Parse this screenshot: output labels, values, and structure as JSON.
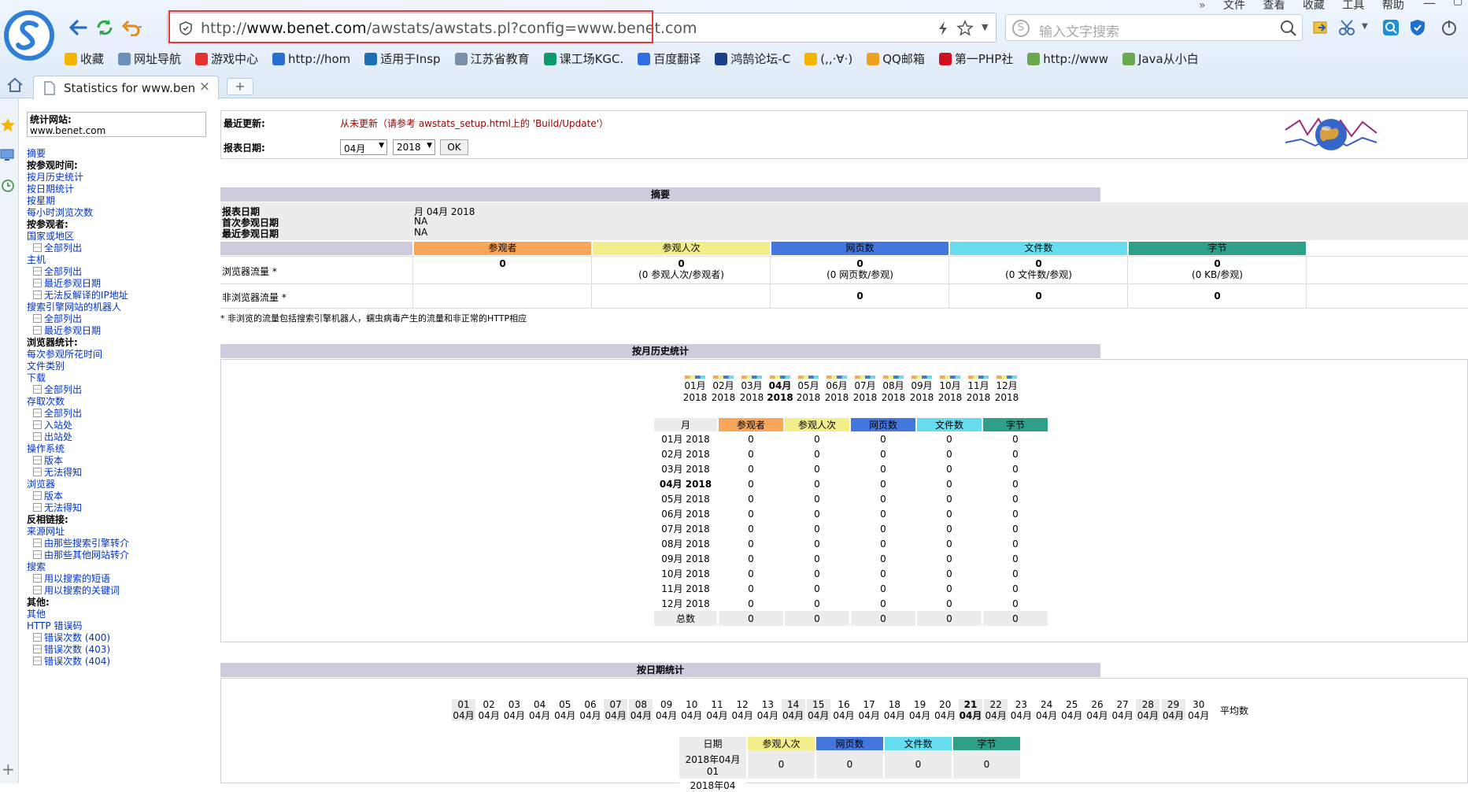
{
  "browser": {
    "url_scheme": "http://",
    "url_host": "www.benet.com",
    "url_path": "/awstats/awstats.pl?config=www.benet.com",
    "search_placeholder": "输入文字搜索",
    "menu": [
      "文件",
      "查看",
      "收藏",
      "工具",
      "帮助"
    ],
    "bookmarks": [
      {
        "label": "收藏",
        "icon": "star-icon",
        "color": "#f5b400"
      },
      {
        "label": "网址导航",
        "icon": "globe-icon",
        "color": "#6a8fb8"
      },
      {
        "label": "游戏中心",
        "icon": "game-icon",
        "color": "#e53030"
      },
      {
        "label": "http://hom",
        "icon": "home-icon",
        "color": "#2a6fd0"
      },
      {
        "label": "适用于Insp",
        "icon": "dell-icon",
        "color": "#1f6fb5"
      },
      {
        "label": "江苏省教育",
        "icon": "doc-icon",
        "color": "#7a8fa8"
      },
      {
        "label": "课工场KGC.",
        "icon": "kgc-icon",
        "color": "#0b9a6a"
      },
      {
        "label": "百度翻译",
        "icon": "translate-icon",
        "color": "#2f6de0"
      },
      {
        "label": "鸿鹄论坛-C",
        "icon": "forum-icon",
        "color": "#1b3f8a"
      },
      {
        "label": "(,,·∀·)",
        "icon": "star-icon",
        "color": "#f5b400"
      },
      {
        "label": "QQ邮箱",
        "icon": "qqmail-icon",
        "color": "#f0a020"
      },
      {
        "label": "第一PHP社",
        "icon": "php-icon",
        "color": "#d0101e"
      },
      {
        "label": "http://www",
        "icon": "page-icon",
        "color": "#6aa84f"
      },
      {
        "label": "Java从小白",
        "icon": "page-icon",
        "color": "#6aa84f"
      }
    ],
    "tab_title": "Statistics for www.ben",
    "tab_new": "+"
  },
  "menu": {
    "site_label": "统计网站:",
    "site_value": "www.benet.com",
    "items": [
      {
        "t": "摘要",
        "k": "link"
      },
      {
        "t": "按参观时间:",
        "k": "head"
      },
      {
        "t": "按月历史统计",
        "k": "link"
      },
      {
        "t": "按日期统计",
        "k": "link"
      },
      {
        "t": "按星期",
        "k": "link"
      },
      {
        "t": "每小时浏览次数",
        "k": "link"
      },
      {
        "t": "按参观者:",
        "k": "head"
      },
      {
        "t": "国家或地区",
        "k": "link"
      },
      {
        "t": "全部列出",
        "k": "sub"
      },
      {
        "t": "主机",
        "k": "link"
      },
      {
        "t": "全部列出",
        "k": "sub"
      },
      {
        "t": "最近参观日期",
        "k": "sub"
      },
      {
        "t": "无法反解译的IP地址",
        "k": "sub"
      },
      {
        "t": "搜索引擎网站的机器人",
        "k": "link"
      },
      {
        "t": "全部列出",
        "k": "sub"
      },
      {
        "t": "最近参观日期",
        "k": "sub"
      },
      {
        "t": "浏览器统计:",
        "k": "head"
      },
      {
        "t": "每次参观所花时间",
        "k": "link"
      },
      {
        "t": "文件类别",
        "k": "link"
      },
      {
        "t": "下载",
        "k": "link"
      },
      {
        "t": "全部列出",
        "k": "sub"
      },
      {
        "t": "存取次数",
        "k": "link"
      },
      {
        "t": "全部列出",
        "k": "sub"
      },
      {
        "t": "入站处",
        "k": "sub"
      },
      {
        "t": "出站处",
        "k": "sub"
      },
      {
        "t": "操作系统",
        "k": "link"
      },
      {
        "t": "版本",
        "k": "sub"
      },
      {
        "t": "无法得知",
        "k": "sub"
      },
      {
        "t": "浏览器",
        "k": "link"
      },
      {
        "t": "版本",
        "k": "sub"
      },
      {
        "t": "无法得知",
        "k": "sub"
      },
      {
        "t": "反相链接:",
        "k": "head"
      },
      {
        "t": "来源网址",
        "k": "link"
      },
      {
        "t": "由那些搜索引擎转介",
        "k": "sub"
      },
      {
        "t": "由那些其他网站转介",
        "k": "sub"
      },
      {
        "t": "搜索",
        "k": "link"
      },
      {
        "t": "用以搜索的短语",
        "k": "sub"
      },
      {
        "t": "用以搜索的关键词",
        "k": "sub"
      },
      {
        "t": "其他:",
        "k": "head"
      },
      {
        "t": "其他",
        "k": "link"
      },
      {
        "t": "HTTP 错误码",
        "k": "link"
      },
      {
        "t": "错误次数 (400)",
        "k": "sub"
      },
      {
        "t": "错误次数 (403)",
        "k": "sub"
      },
      {
        "t": "错误次数 (404)",
        "k": "sub"
      }
    ]
  },
  "info": {
    "update_label": "最近更新:",
    "update_value": "从未更新（请参考 awstats_setup.html上的 'Build/Update'）",
    "date_label": "报表日期:",
    "month_value": "04月",
    "year_value": "2018",
    "ok_label": "OK"
  },
  "summary": {
    "title": "摘要",
    "rows": [
      {
        "label": "报表日期",
        "value": "月 04月 2018"
      },
      {
        "label": "首次参观日期",
        "value": "NA"
      },
      {
        "label": "最近参观日期",
        "value": "NA"
      }
    ],
    "headers": [
      "参观者",
      "参观人次",
      "网页数",
      "文件数",
      "字节"
    ],
    "header_colors": [
      "#f9a65a",
      "#f4ee8a",
      "#4477dd",
      "#66ddee",
      "#2ea08a"
    ],
    "browser_label": "浏览器流量 *",
    "browser_values": [
      {
        "main": "0",
        "sub": ""
      },
      {
        "main": "0",
        "sub": "(0 参观人次/参观者)"
      },
      {
        "main": "0",
        "sub": "(0 网页数/参观)"
      },
      {
        "main": "0",
        "sub": "(0 文件数/参观)"
      },
      {
        "main": "0",
        "sub": "(0 KB/参观)"
      }
    ],
    "nonbrowser_label": "非浏览器流量 *",
    "nonbrowser_values": [
      "0",
      "0",
      "0"
    ],
    "note": "* 非浏览的流量包括搜索引擎机器人，蠕虫病毒产生的流量和非正常的HTTP相应"
  },
  "monthly": {
    "title": "按月历史统计",
    "months": [
      {
        "m": "01月",
        "y": "2018"
      },
      {
        "m": "02月",
        "y": "2018"
      },
      {
        "m": "03月",
        "y": "2018"
      },
      {
        "m": "04月",
        "y": "2018",
        "bold": true
      },
      {
        "m": "05月",
        "y": "2018"
      },
      {
        "m": "06月",
        "y": "2018"
      },
      {
        "m": "07月",
        "y": "2018"
      },
      {
        "m": "08月",
        "y": "2018"
      },
      {
        "m": "09月",
        "y": "2018"
      },
      {
        "m": "10月",
        "y": "2018"
      },
      {
        "m": "11月",
        "y": "2018"
      },
      {
        "m": "12月",
        "y": "2018"
      }
    ],
    "table_headers": [
      "月",
      "参观者",
      "参观人次",
      "网页数",
      "文件数",
      "字节"
    ],
    "rows": [
      [
        "01月 2018",
        "0",
        "0",
        "0",
        "0",
        "0"
      ],
      [
        "02月 2018",
        "0",
        "0",
        "0",
        "0",
        "0"
      ],
      [
        "03月 2018",
        "0",
        "0",
        "0",
        "0",
        "0"
      ],
      [
        "04月 2018",
        "0",
        "0",
        "0",
        "0",
        "0"
      ],
      [
        "05月 2018",
        "0",
        "0",
        "0",
        "0",
        "0"
      ],
      [
        "06月 2018",
        "0",
        "0",
        "0",
        "0",
        "0"
      ],
      [
        "07月 2018",
        "0",
        "0",
        "0",
        "0",
        "0"
      ],
      [
        "08月 2018",
        "0",
        "0",
        "0",
        "0",
        "0"
      ],
      [
        "09月 2018",
        "0",
        "0",
        "0",
        "0",
        "0"
      ],
      [
        "10月 2018",
        "0",
        "0",
        "0",
        "0",
        "0"
      ],
      [
        "11月 2018",
        "0",
        "0",
        "0",
        "0",
        "0"
      ],
      [
        "12月 2018",
        "0",
        "0",
        "0",
        "0",
        "0"
      ]
    ],
    "bold_row": 3,
    "total_row": [
      "总数",
      "0",
      "0",
      "0",
      "0",
      "0"
    ]
  },
  "daily": {
    "title": "按日期统计",
    "days": [
      {
        "d": "01",
        "we": true
      },
      {
        "d": "02"
      },
      {
        "d": "03"
      },
      {
        "d": "04"
      },
      {
        "d": "05"
      },
      {
        "d": "06"
      },
      {
        "d": "07",
        "we": true
      },
      {
        "d": "08",
        "we": true
      },
      {
        "d": "09"
      },
      {
        "d": "10"
      },
      {
        "d": "11"
      },
      {
        "d": "12"
      },
      {
        "d": "13"
      },
      {
        "d": "14",
        "we": true
      },
      {
        "d": "15",
        "we": true
      },
      {
        "d": "16"
      },
      {
        "d": "17"
      },
      {
        "d": "18"
      },
      {
        "d": "19"
      },
      {
        "d": "20"
      },
      {
        "d": "21",
        "we": true,
        "bold": true
      },
      {
        "d": "22",
        "we": true
      },
      {
        "d": "23"
      },
      {
        "d": "24"
      },
      {
        "d": "25"
      },
      {
        "d": "26"
      },
      {
        "d": "27"
      },
      {
        "d": "28",
        "we": true
      },
      {
        "d": "29",
        "we": true
      },
      {
        "d": "30"
      }
    ],
    "month": "04月",
    "avg_label": "平均数",
    "table_headers": [
      "日期",
      "参观人次",
      "网页数",
      "文件数",
      "字节"
    ],
    "first_row": [
      "2018年04月01",
      "0",
      "0",
      "0",
      "0"
    ],
    "second_row_partial": "2018年04"
  }
}
